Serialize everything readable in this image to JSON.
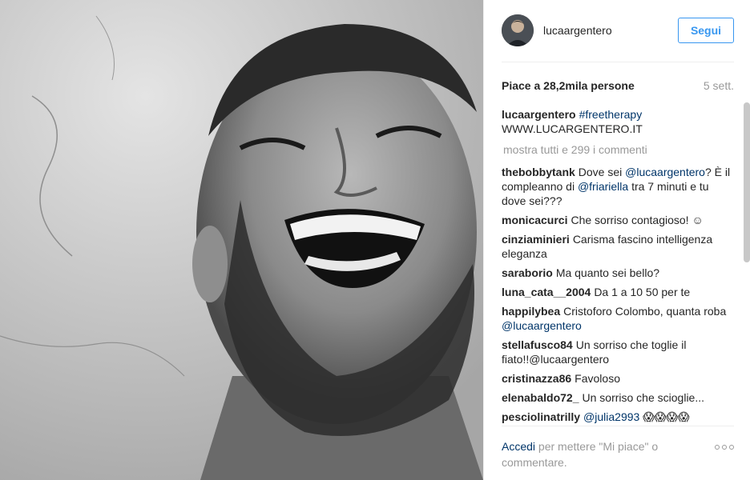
{
  "post": {
    "username": "lucaargentero",
    "follow_label": "Segui",
    "likes_text": "Piace a 28,2mila persone",
    "time_ago": "5 sett.",
    "caption": {
      "author": "lucaargentero",
      "hashtag": "#freetherapy",
      "url": "WWW.LUCARGENTERO.IT"
    },
    "show_all_comments": "mostra tutti e 299 i commenti"
  },
  "comments": [
    {
      "author": "thebobbytank",
      "text_before": "Dove sei ",
      "mention": "@lucaargentero",
      "text_after": "? È il compleanno di ",
      "mention2": "@friariella",
      "text_after2": " tra 7 minuti e tu dove sei???"
    },
    {
      "author": "monicacurci",
      "text": "Che sorriso contagioso! ☺"
    },
    {
      "author": "cinziaminieri",
      "text": "Carisma fascino intelligenza eleganza"
    },
    {
      "author": "saraborio",
      "text": "Ma quanto sei bello?"
    },
    {
      "author": "luna_cata__2004",
      "text": "Da 1 a 10 50 per te"
    },
    {
      "author": "happilybea",
      "text": "Cristoforo Colombo, quanta roba ",
      "mention": "@lucaargentero"
    },
    {
      "author": "stellafusco84",
      "text": "Un sorriso che toglie il fiato!!@lucaargentero"
    },
    {
      "author": "cristinazza86",
      "text": "Favoloso"
    },
    {
      "author": "elenabaldo72_",
      "text": "Un sorriso che scioglie..."
    },
    {
      "author": "pesciolinatrilly",
      "mention": "@julia2993",
      "text": " 😱😱😱😱"
    }
  ],
  "footer": {
    "login_link": "Accedi",
    "login_text": " per mettere \"Mi piace\" o commentare.",
    "more_icon": "ellipsis-icon"
  },
  "colors": {
    "link": "#003569",
    "follow_blue": "#3897f0",
    "muted": "#999999",
    "text": "#262626"
  }
}
